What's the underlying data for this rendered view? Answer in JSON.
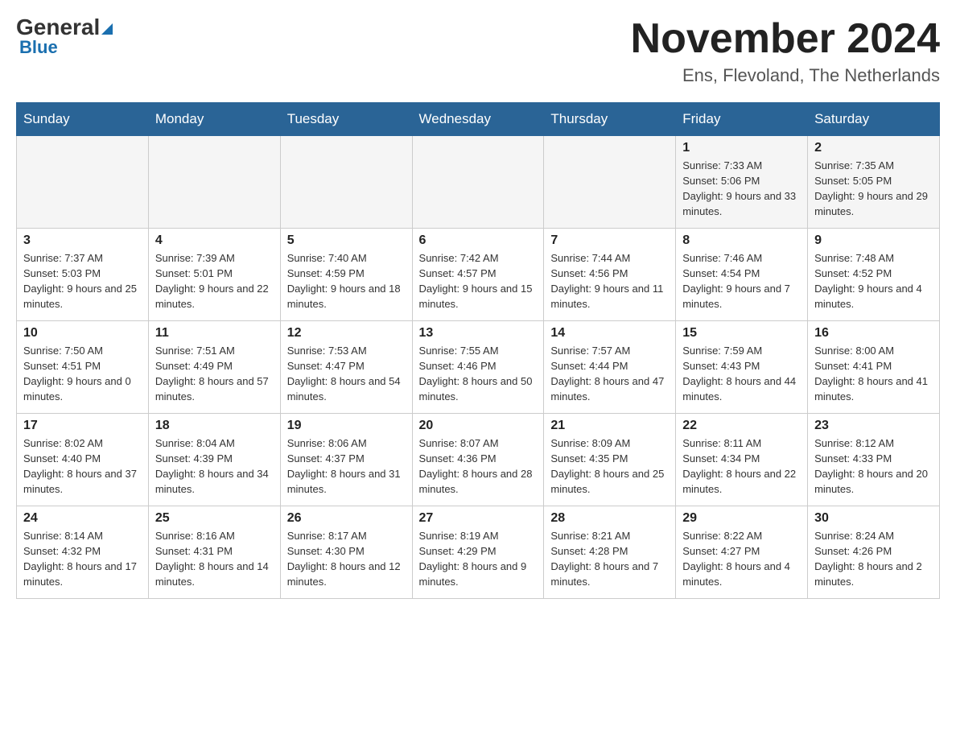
{
  "header": {
    "logo_main": "General",
    "logo_blue": "Blue",
    "month_title": "November 2024",
    "subtitle": "Ens, Flevoland, The Netherlands"
  },
  "days_of_week": [
    "Sunday",
    "Monday",
    "Tuesday",
    "Wednesday",
    "Thursday",
    "Friday",
    "Saturday"
  ],
  "weeks": [
    [
      {
        "day": "",
        "info": ""
      },
      {
        "day": "",
        "info": ""
      },
      {
        "day": "",
        "info": ""
      },
      {
        "day": "",
        "info": ""
      },
      {
        "day": "",
        "info": ""
      },
      {
        "day": "1",
        "info": "Sunrise: 7:33 AM\nSunset: 5:06 PM\nDaylight: 9 hours and 33 minutes."
      },
      {
        "day": "2",
        "info": "Sunrise: 7:35 AM\nSunset: 5:05 PM\nDaylight: 9 hours and 29 minutes."
      }
    ],
    [
      {
        "day": "3",
        "info": "Sunrise: 7:37 AM\nSunset: 5:03 PM\nDaylight: 9 hours and 25 minutes."
      },
      {
        "day": "4",
        "info": "Sunrise: 7:39 AM\nSunset: 5:01 PM\nDaylight: 9 hours and 22 minutes."
      },
      {
        "day": "5",
        "info": "Sunrise: 7:40 AM\nSunset: 4:59 PM\nDaylight: 9 hours and 18 minutes."
      },
      {
        "day": "6",
        "info": "Sunrise: 7:42 AM\nSunset: 4:57 PM\nDaylight: 9 hours and 15 minutes."
      },
      {
        "day": "7",
        "info": "Sunrise: 7:44 AM\nSunset: 4:56 PM\nDaylight: 9 hours and 11 minutes."
      },
      {
        "day": "8",
        "info": "Sunrise: 7:46 AM\nSunset: 4:54 PM\nDaylight: 9 hours and 7 minutes."
      },
      {
        "day": "9",
        "info": "Sunrise: 7:48 AM\nSunset: 4:52 PM\nDaylight: 9 hours and 4 minutes."
      }
    ],
    [
      {
        "day": "10",
        "info": "Sunrise: 7:50 AM\nSunset: 4:51 PM\nDaylight: 9 hours and 0 minutes."
      },
      {
        "day": "11",
        "info": "Sunrise: 7:51 AM\nSunset: 4:49 PM\nDaylight: 8 hours and 57 minutes."
      },
      {
        "day": "12",
        "info": "Sunrise: 7:53 AM\nSunset: 4:47 PM\nDaylight: 8 hours and 54 minutes."
      },
      {
        "day": "13",
        "info": "Sunrise: 7:55 AM\nSunset: 4:46 PM\nDaylight: 8 hours and 50 minutes."
      },
      {
        "day": "14",
        "info": "Sunrise: 7:57 AM\nSunset: 4:44 PM\nDaylight: 8 hours and 47 minutes."
      },
      {
        "day": "15",
        "info": "Sunrise: 7:59 AM\nSunset: 4:43 PM\nDaylight: 8 hours and 44 minutes."
      },
      {
        "day": "16",
        "info": "Sunrise: 8:00 AM\nSunset: 4:41 PM\nDaylight: 8 hours and 41 minutes."
      }
    ],
    [
      {
        "day": "17",
        "info": "Sunrise: 8:02 AM\nSunset: 4:40 PM\nDaylight: 8 hours and 37 minutes."
      },
      {
        "day": "18",
        "info": "Sunrise: 8:04 AM\nSunset: 4:39 PM\nDaylight: 8 hours and 34 minutes."
      },
      {
        "day": "19",
        "info": "Sunrise: 8:06 AM\nSunset: 4:37 PM\nDaylight: 8 hours and 31 minutes."
      },
      {
        "day": "20",
        "info": "Sunrise: 8:07 AM\nSunset: 4:36 PM\nDaylight: 8 hours and 28 minutes."
      },
      {
        "day": "21",
        "info": "Sunrise: 8:09 AM\nSunset: 4:35 PM\nDaylight: 8 hours and 25 minutes."
      },
      {
        "day": "22",
        "info": "Sunrise: 8:11 AM\nSunset: 4:34 PM\nDaylight: 8 hours and 22 minutes."
      },
      {
        "day": "23",
        "info": "Sunrise: 8:12 AM\nSunset: 4:33 PM\nDaylight: 8 hours and 20 minutes."
      }
    ],
    [
      {
        "day": "24",
        "info": "Sunrise: 8:14 AM\nSunset: 4:32 PM\nDaylight: 8 hours and 17 minutes."
      },
      {
        "day": "25",
        "info": "Sunrise: 8:16 AM\nSunset: 4:31 PM\nDaylight: 8 hours and 14 minutes."
      },
      {
        "day": "26",
        "info": "Sunrise: 8:17 AM\nSunset: 4:30 PM\nDaylight: 8 hours and 12 minutes."
      },
      {
        "day": "27",
        "info": "Sunrise: 8:19 AM\nSunset: 4:29 PM\nDaylight: 8 hours and 9 minutes."
      },
      {
        "day": "28",
        "info": "Sunrise: 8:21 AM\nSunset: 4:28 PM\nDaylight: 8 hours and 7 minutes."
      },
      {
        "day": "29",
        "info": "Sunrise: 8:22 AM\nSunset: 4:27 PM\nDaylight: 8 hours and 4 minutes."
      },
      {
        "day": "30",
        "info": "Sunrise: 8:24 AM\nSunset: 4:26 PM\nDaylight: 8 hours and 2 minutes."
      }
    ]
  ]
}
